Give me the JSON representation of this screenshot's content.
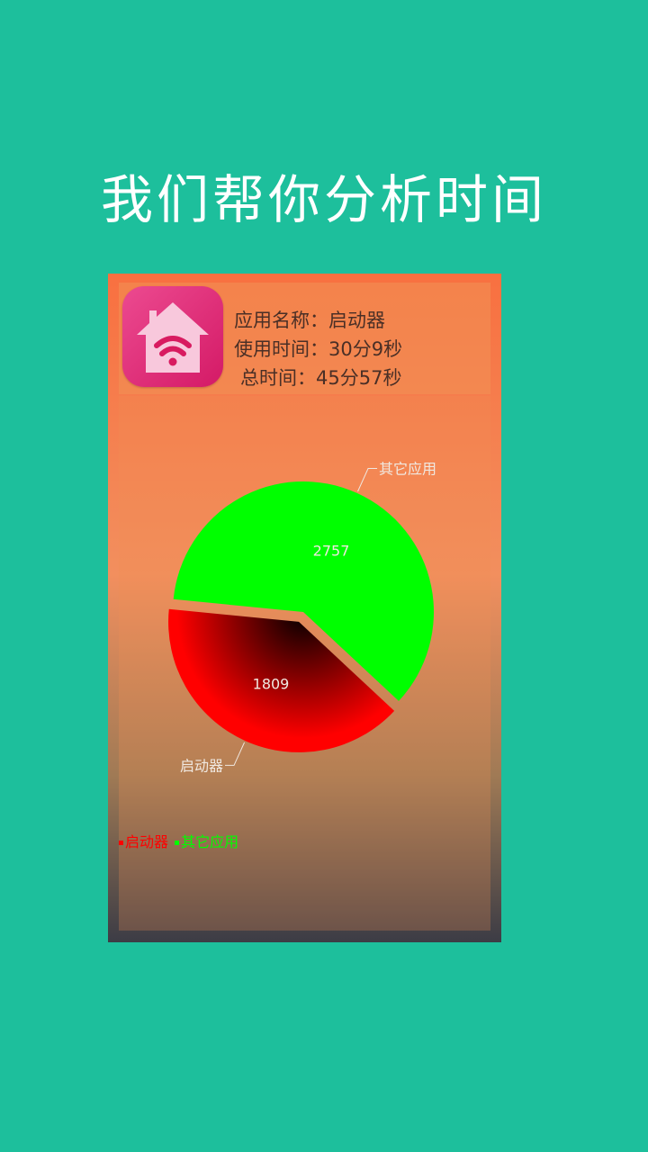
{
  "headline": "我们帮你分析时间",
  "app": {
    "icon": "home-wifi-icon",
    "name_line": "应用名称：启动器",
    "usage_line": "使用时间：30分9秒",
    "total_line": "总时间：45分57秒"
  },
  "chart_data": {
    "type": "pie",
    "slices": [
      {
        "label": "启动器",
        "value": 1809,
        "color": "#ff0000",
        "exploded": true
      },
      {
        "label": "其它应用",
        "value": 2757,
        "color": "#00ff00",
        "exploded": false
      }
    ],
    "legend": [
      "启动器",
      "其它应用"
    ],
    "legend_placement": "bottom-left"
  },
  "colors": {
    "background": "#1dbf9c",
    "label_text": "#f0e8e0",
    "legend_launcher": "#ff0000",
    "legend_other": "#00ff00"
  }
}
